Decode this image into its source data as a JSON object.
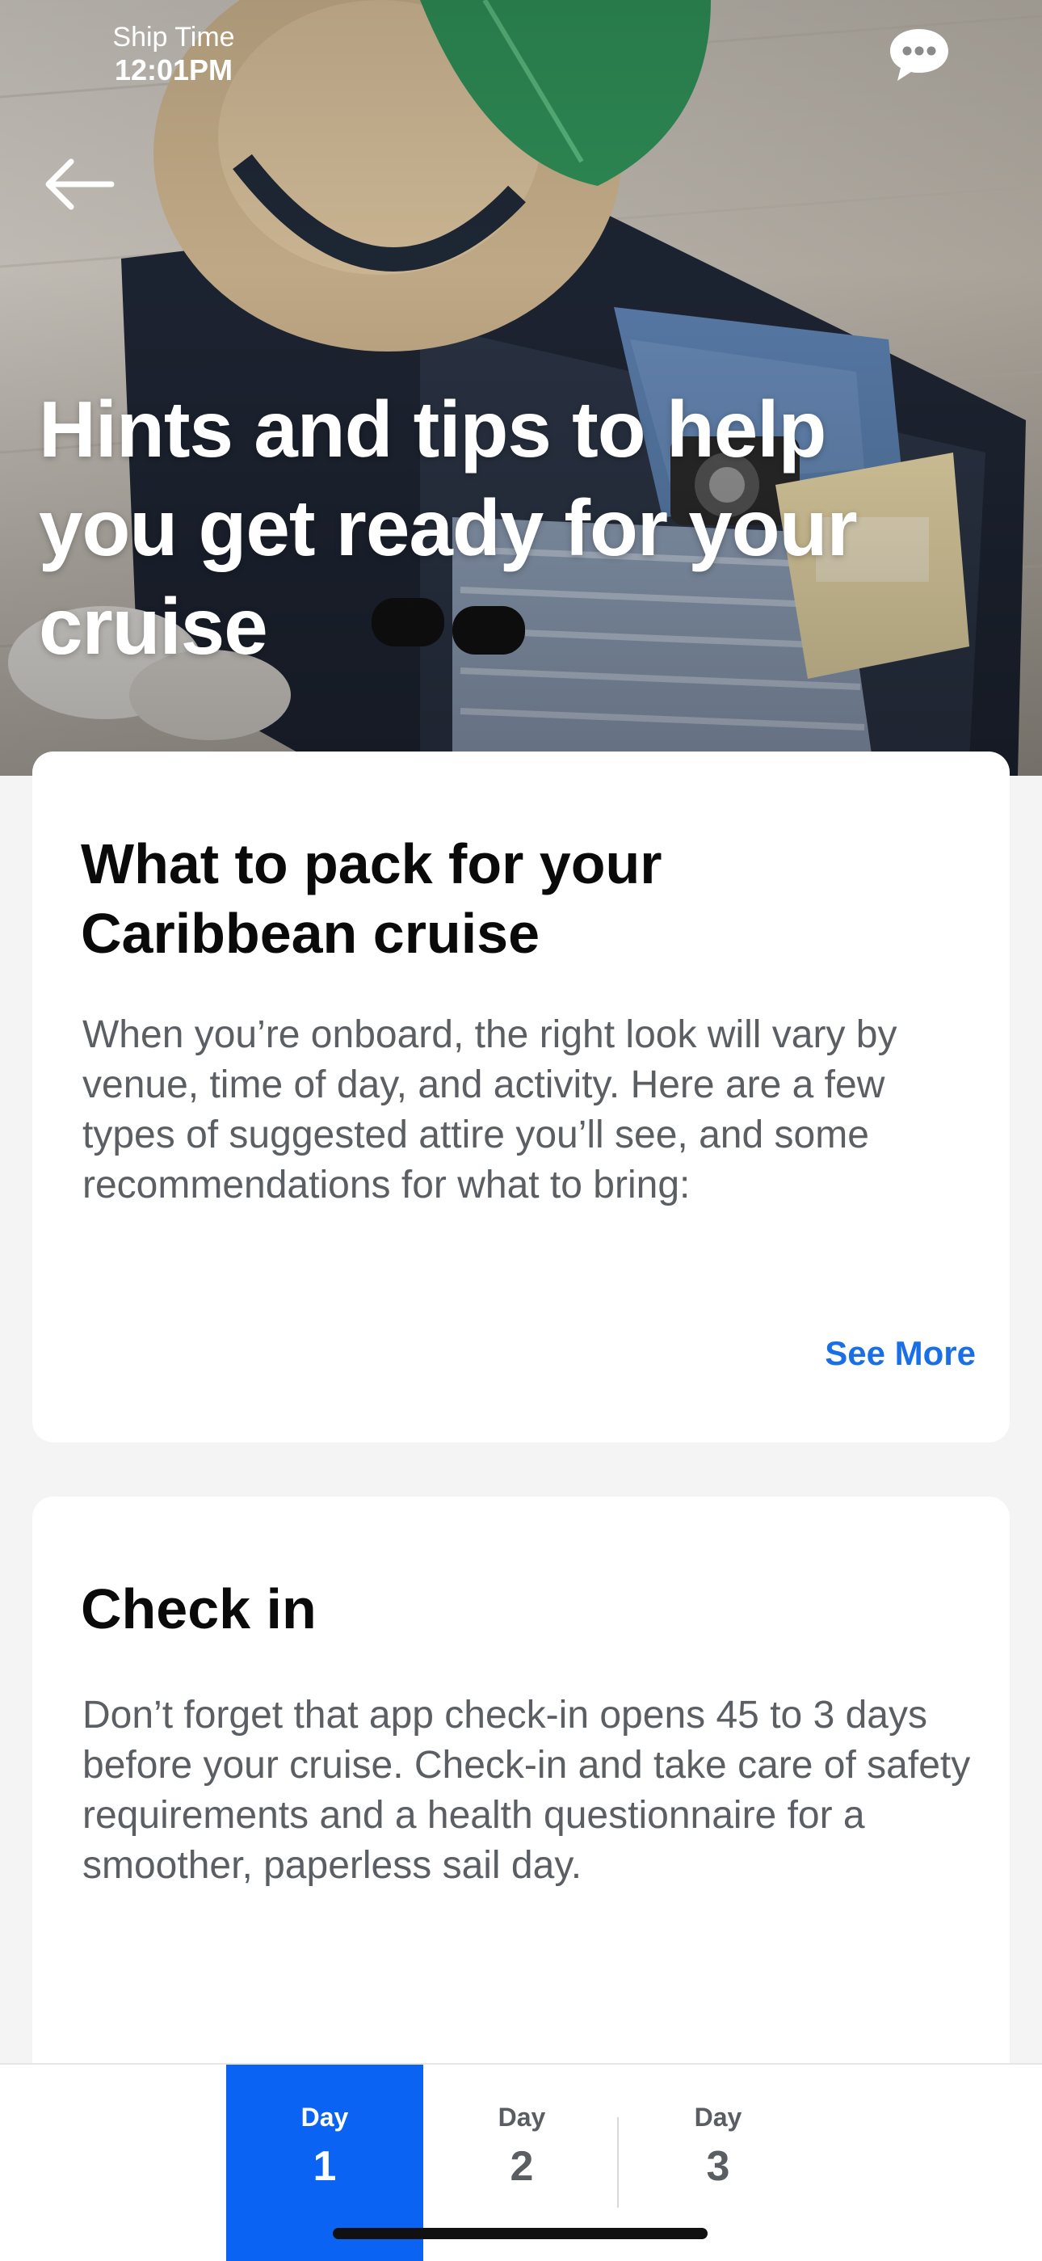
{
  "status": {
    "ship_time_label": "Ship Time",
    "ship_time_value": "12:01PM"
  },
  "hero": {
    "title": "Hints and tips to help you get ready for your cruise"
  },
  "cards": [
    {
      "title": "What to pack for your Caribbean cruise",
      "body": "When you’re onboard, the right look will vary by venue, time of day, and activity. Here are a few types of suggested attire you’ll see, and some recommendations for what to bring:",
      "link": "See More"
    },
    {
      "title": "Check in",
      "body": "Don’t forget that app check-in opens 45 to 3 days before your cruise. Check-in and take care of safety requirements and a health questionnaire for a smoother, paperless sail day."
    }
  ],
  "day_tabs": [
    {
      "label": "Day",
      "number": "1",
      "selected": true
    },
    {
      "label": "Day",
      "number": "2",
      "selected": false
    },
    {
      "label": "Day",
      "number": "3",
      "selected": false
    }
  ],
  "colors": {
    "accent": "#0b63f3",
    "link": "#1a6fe6",
    "page_background": "#f4f4f4",
    "body_text": "#5b5f63"
  },
  "icons": [
    "chat-bubble-icon",
    "back-arrow-icon"
  ]
}
